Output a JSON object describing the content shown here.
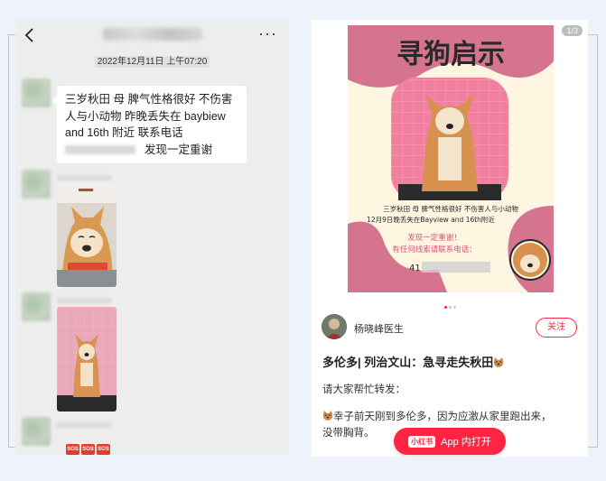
{
  "chat": {
    "timestamp": "2022年12月11日 上午07:20",
    "message_lines": [
      "三岁秋田 母 脾气性格很好 不伤害",
      "人与小动物 昨晚丢失在 baybiew",
      "and 16th 附近    联系电话"
    ],
    "message_last": "发现一定重谢",
    "sos_labels": [
      "SOS",
      "SOS",
      "SOS"
    ]
  },
  "post": {
    "counter": "1/3",
    "poster": {
      "title": "寻狗启示",
      "line1": "三岁秋田 母 脾气性格很好 不伤害人与小动物",
      "line2": "12月9日晚丢失在Bayview and 16th附近",
      "reward1": "发现一定重谢！",
      "reward2": "有任何线索请联系电话：",
      "phone_prefix": "41"
    },
    "author": "杨晓峰医生",
    "follow_label": "关注",
    "title": "多伦多| 列治文山：急寻走失秋田",
    "body_line1": "请大家帮忙转发：",
    "body_line2": "幸子前天刚到多伦多，因为应激从家里跑出来，",
    "body_line3": "没带胸背。",
    "open_app_logo": "小红书",
    "open_app_label": "App 内打开"
  },
  "colors": {
    "accent": "#ff2442",
    "poster_pink": "#d4748f",
    "poster_bg": "#fff6e2"
  }
}
